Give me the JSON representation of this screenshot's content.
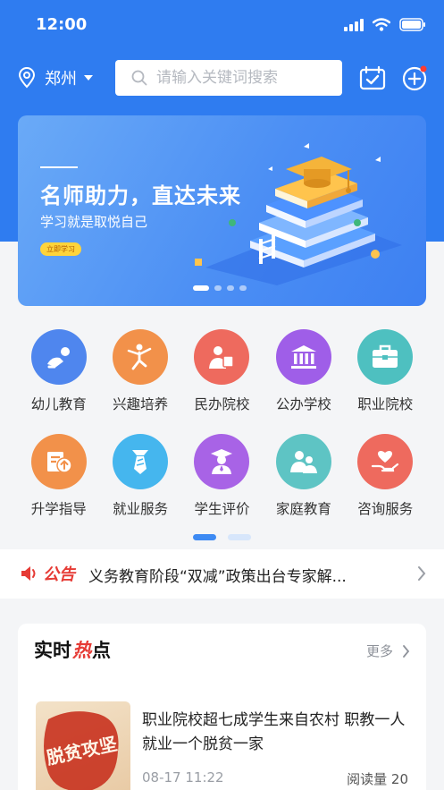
{
  "status": {
    "time": "12:00"
  },
  "header": {
    "city": "郑州",
    "search_placeholder": "请输入关键词搜索"
  },
  "banner": {
    "title": "名师助力，直达未来",
    "subtitle": "学习就是取悦自己",
    "button": "立即学习",
    "active_slide": 1,
    "slide_count": 4
  },
  "categories": [
    {
      "label": "幼儿教育",
      "icon": "crawling-baby-icon",
      "color": "#4f86ee"
    },
    {
      "label": "兴趣培养",
      "icon": "dancer-icon",
      "color": "#f2914a"
    },
    {
      "label": "民办院校",
      "icon": "reader-icon",
      "color": "#ee6a5e"
    },
    {
      "label": "公办学校",
      "icon": "institution-icon",
      "color": "#9f5ee8"
    },
    {
      "label": "职业院校",
      "icon": "briefcase-icon",
      "color": "#4ec0c0"
    },
    {
      "label": "升学指导",
      "icon": "upgrade-icon",
      "color": "#f2914a"
    },
    {
      "label": "就业服务",
      "icon": "necktie-icon",
      "color": "#45b6ee"
    },
    {
      "label": "学生评价",
      "icon": "graduate-icon",
      "color": "#a863e6"
    },
    {
      "label": "家庭教育",
      "icon": "family-icon",
      "color": "#5ec4c4"
    },
    {
      "label": "咨询服务",
      "icon": "heart-hand-icon",
      "color": "#ee6a5e"
    }
  ],
  "notice": {
    "tag": "公告",
    "text": "义务教育阶段“双减”政策出台专家解..."
  },
  "hot": {
    "title_prefix": "实时",
    "title_hot": "热",
    "title_suffix": "点",
    "more": "更多",
    "thumb_text": "脱贫攻坚",
    "news": {
      "title": "职业院校超七成学生来自农村 职教一人就业一个脱贫一家",
      "time": "08-17 11:22",
      "reads": "阅读量 20"
    }
  },
  "colors": {
    "primary": "#2f7cf0",
    "notice_red": "#e63b35"
  }
}
